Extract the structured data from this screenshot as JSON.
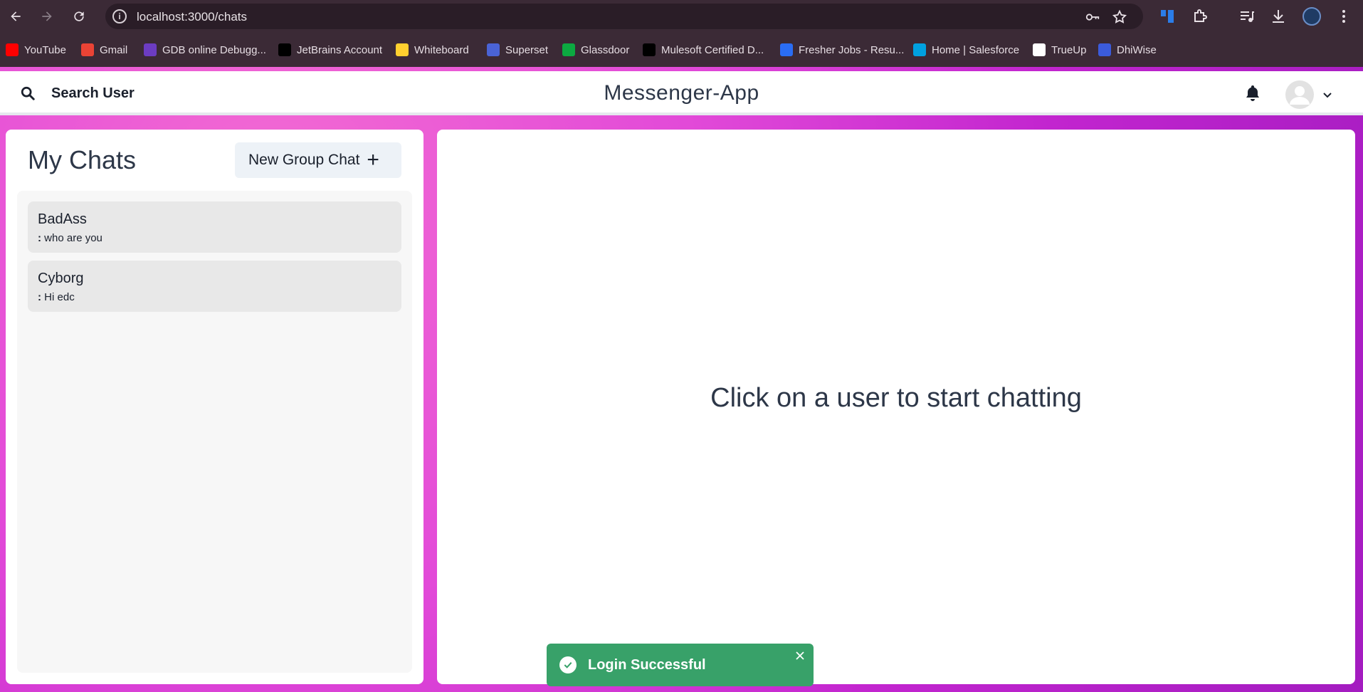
{
  "browser": {
    "url": "localhost:3000/chats",
    "bookmarks": [
      {
        "label": "YouTube",
        "icon": "youtube-icon",
        "color": "#ff0000"
      },
      {
        "label": "Gmail",
        "icon": "gmail-icon",
        "color": "#ea4335"
      },
      {
        "label": "GDB online Debugg...",
        "icon": "gdb-icon",
        "color": "#6c3cc2"
      },
      {
        "label": "JetBrains Account",
        "icon": "jetbrains-icon",
        "color": "#000000"
      },
      {
        "label": "Whiteboard",
        "icon": "miro-icon",
        "color": "#ffd02f"
      },
      {
        "label": "Superset",
        "icon": "superset-icon",
        "color": "#4a63d6"
      },
      {
        "label": "Glassdoor",
        "icon": "glassdoor-icon",
        "color": "#0caa41"
      },
      {
        "label": "Mulesoft Certified D...",
        "icon": "medium-icon",
        "color": "#000000"
      },
      {
        "label": "Fresher Jobs - Resu...",
        "icon": "fresher-jobs-icon",
        "color": "#2a6df4"
      },
      {
        "label": "Home | Salesforce",
        "icon": "salesforce-icon",
        "color": "#00a1e0"
      },
      {
        "label": "TrueUp",
        "icon": "trueup-icon",
        "color": "#ffffff"
      },
      {
        "label": "DhiWise",
        "icon": "dhiwise-icon",
        "color": "#3b5bdb"
      }
    ]
  },
  "header": {
    "search_label": "Search User",
    "brand": "Messenger-App"
  },
  "sidebar": {
    "title": "My Chats",
    "new_group_label": "New Group Chat",
    "chats": [
      {
        "name": "BadAss",
        "prefix": ":",
        "message": "who are you"
      },
      {
        "name": "Cyborg",
        "prefix": ":",
        "message": "Hi edc"
      }
    ]
  },
  "main": {
    "empty_message": "Click on a user to start chatting"
  },
  "toast": {
    "message": "Login Successful",
    "color": "#38a169"
  }
}
